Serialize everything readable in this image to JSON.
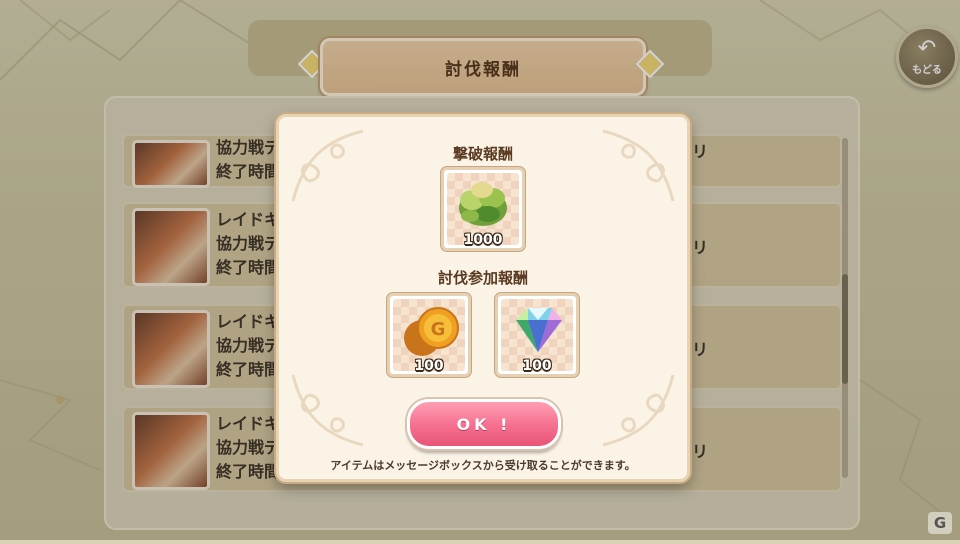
{
  "header": {
    "title": "討伐報酬",
    "back_label": "もどる",
    "back_icon": "back-arrow-icon"
  },
  "list": {
    "rows": [
      {
        "line1": "協力戦デ",
        "line2": "終了時間",
        "right": "リ"
      },
      {
        "line1": "レイドキ",
        "line2": "協力戦デ",
        "line3": "終了時間",
        "right": "リ"
      },
      {
        "line1": "レイドキ",
        "line2": "協力戦デ",
        "line3": "終了時間",
        "right": "リ"
      },
      {
        "line1": "レイドキ",
        "line2": "協力戦デ",
        "line3": "終了時間",
        "right": "リ"
      }
    ]
  },
  "modal": {
    "defeat_reward_title": "撃破報酬",
    "defeat_rewards": [
      {
        "icon": "herb-material-icon",
        "count": "1000"
      }
    ],
    "participation_reward_title": "討伐参加報酬",
    "participation_rewards": [
      {
        "icon": "gold-coin-icon",
        "count": "100"
      },
      {
        "icon": "rainbow-gem-icon",
        "count": "100"
      }
    ],
    "ok_label": "OK !",
    "footnote": "アイテムはメッセージボックスから受け取ることができます。"
  },
  "watermark": {
    "label": "G"
  },
  "colors": {
    "accent_pink": "#f56f8f",
    "title_text": "#5b3a22",
    "modal_bg": "#fbf4e6"
  }
}
